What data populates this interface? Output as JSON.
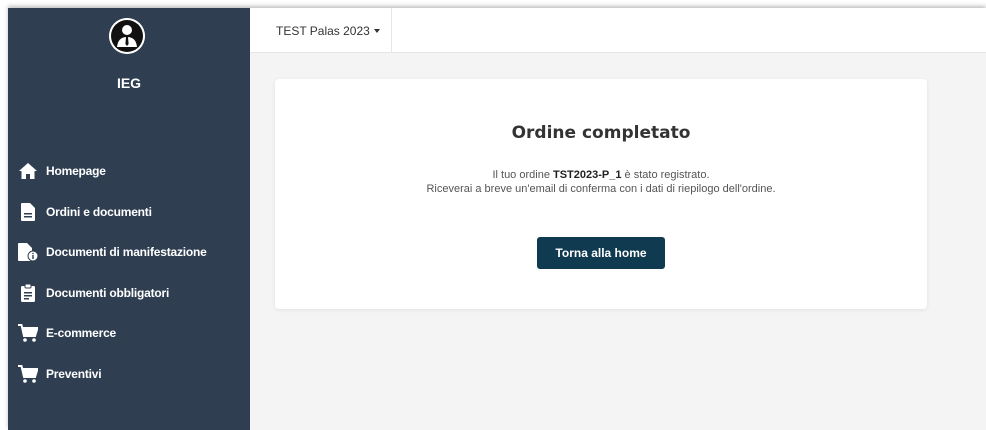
{
  "sidebar": {
    "brand": "IEG",
    "items": [
      {
        "label": "Homepage",
        "icon": "home-icon"
      },
      {
        "label": "Ordini e documenti",
        "icon": "document-icon"
      },
      {
        "label": "Documenti di manifestazione",
        "icon": "document-info-icon"
      },
      {
        "label": "Documenti obbligatori",
        "icon": "clipboard-icon"
      },
      {
        "label": "E-commerce",
        "icon": "cart-icon"
      },
      {
        "label": "Preventivi",
        "icon": "cart-icon"
      }
    ]
  },
  "header": {
    "event_selector": "TEST Palas 2023"
  },
  "card": {
    "title": "Ordine completato",
    "line1_prefix": "Il tuo ordine ",
    "order_code": "TST2023-P_1",
    "line1_suffix": " è stato registrato.",
    "line2": "Riceverai a breve un'email di conferma con i dati di riepilogo dell'ordine.",
    "button_label": "Torna alla home"
  },
  "colors": {
    "sidebar_bg": "#2f3f51",
    "button_bg": "#0f3a50",
    "page_bg": "#f4f4f4"
  }
}
